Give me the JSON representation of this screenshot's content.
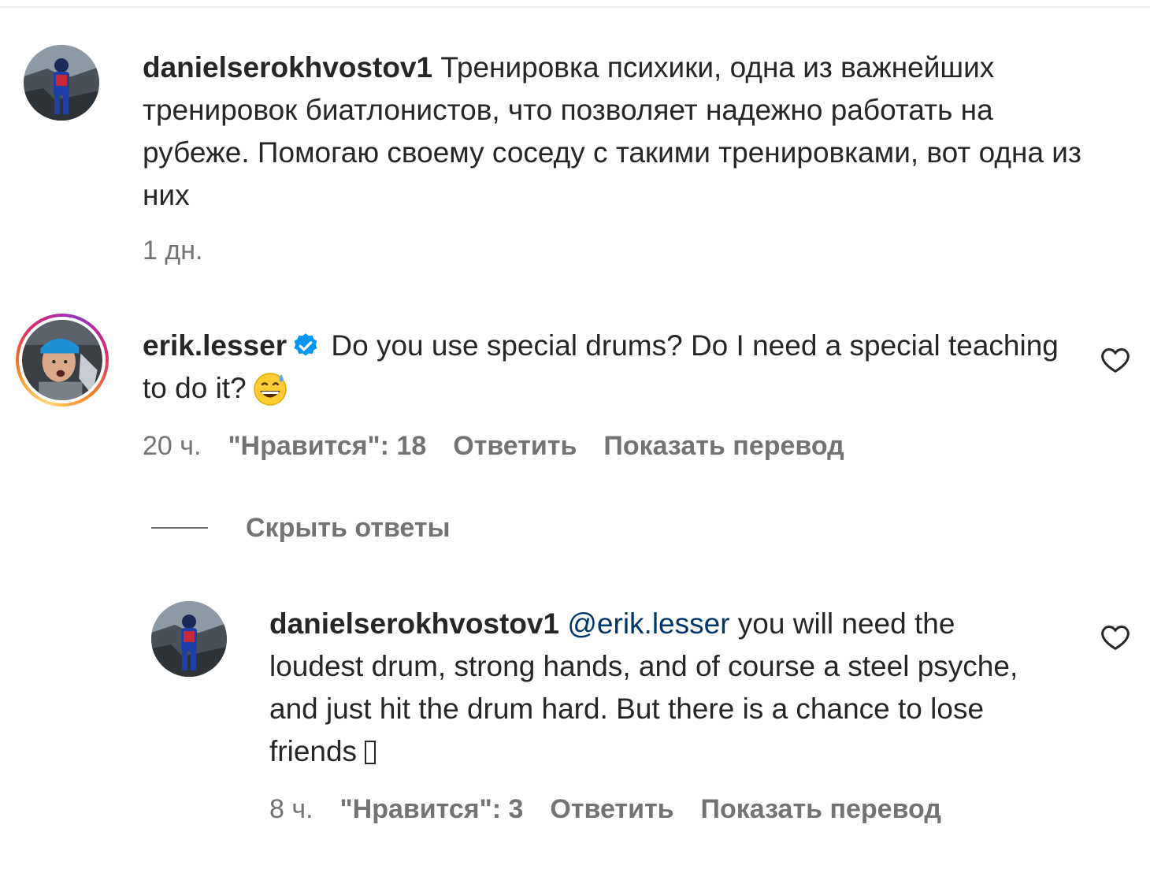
{
  "comments": [
    {
      "username": "danielserokhvostov1",
      "text": " Тренировка психики, одна из важнейших тренировок биатлонистов, что позволяет надежно работать на рубеже. Помогаю своему соседу с такими тренировками, вот одна из них",
      "time": "1 дн.",
      "avatar_icon": "skier-avatar"
    },
    {
      "username": "erik.lesser",
      "verified": true,
      "text": " Do you use special drums? Do I need a special teaching to do it?",
      "emoji": "grinning-face-with-sweat",
      "time": "20 ч.",
      "likes": "\"Нравится\": 18",
      "reply_label": "Ответить",
      "translate_label": "Показать перевод",
      "hide_replies_label": "Скрыть ответы"
    }
  ],
  "reply": {
    "username": "danielserokhvostov1",
    "mention": "@erik.lesser",
    "text": " you will need the loudest drum, strong hands, and of course a steel psyche, and just hit the drum hard. But there is a chance to lose friends",
    "time": "8 ч.",
    "likes": "\"Нравится\": 3",
    "reply_label": "Ответить",
    "translate_label": "Показать перевод"
  },
  "colors": {
    "text": "#262626",
    "secondary": "#737373",
    "verified": "#0095f6",
    "mention": "#00376b"
  }
}
